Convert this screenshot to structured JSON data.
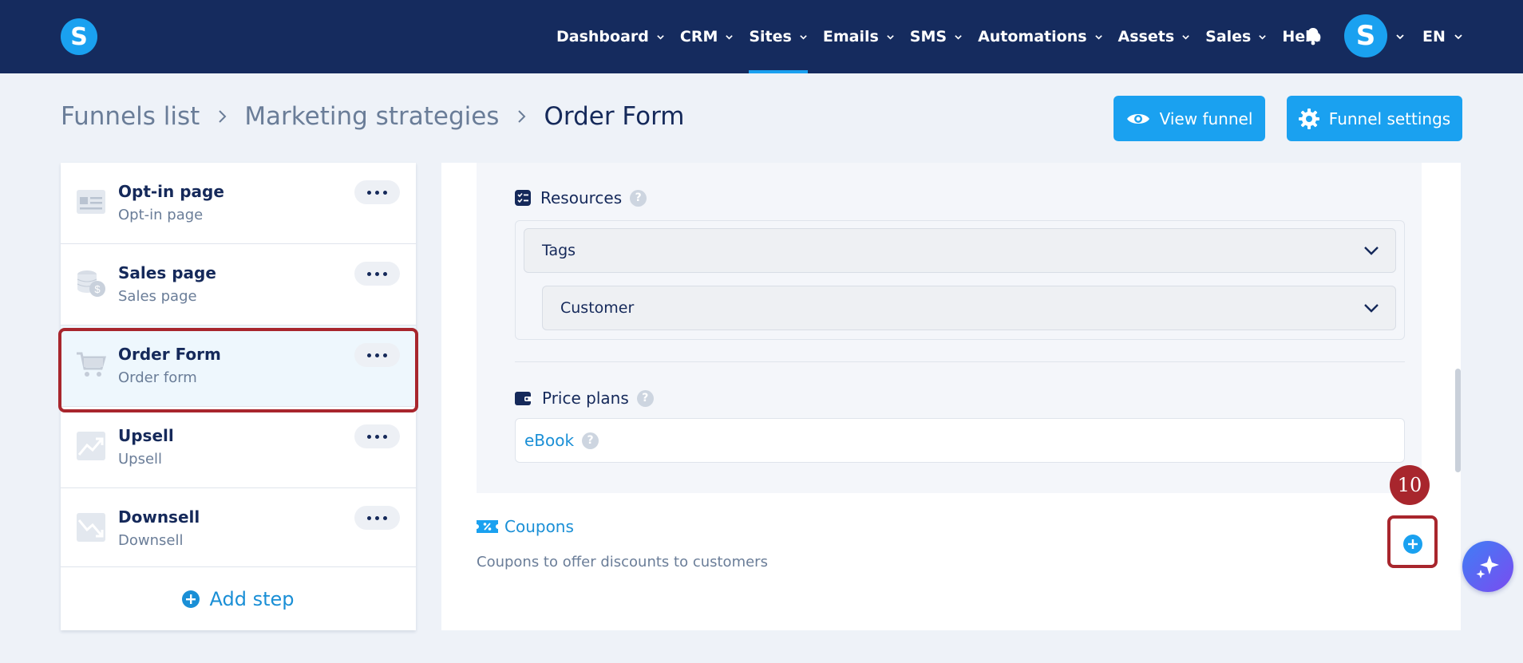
{
  "nav": {
    "items": [
      {
        "label": "Dashboard",
        "has_menu": true
      },
      {
        "label": "CRM",
        "has_menu": true
      },
      {
        "label": "Sites",
        "has_menu": true,
        "active": true
      },
      {
        "label": "Emails",
        "has_menu": true
      },
      {
        "label": "SMS",
        "has_menu": true
      },
      {
        "label": "Automations",
        "has_menu": true
      },
      {
        "label": "Assets",
        "has_menu": true
      },
      {
        "label": "Sales",
        "has_menu": true
      },
      {
        "label": "Help",
        "has_menu": false
      }
    ],
    "logo_letter": "S",
    "avatar_letter": "S",
    "language": "EN"
  },
  "breadcrumb": {
    "items": [
      "Funnels list",
      "Marketing strategies",
      "Order Form"
    ]
  },
  "header": {
    "view_funnel_label": "View funnel",
    "funnel_settings_label": "Funnel settings"
  },
  "steps": {
    "items": [
      {
        "title": "Opt-in page",
        "subtitle": "Opt-in page",
        "icon": "opt-in-page-icon"
      },
      {
        "title": "Sales page",
        "subtitle": "Sales page",
        "icon": "coins-icon"
      },
      {
        "title": "Order Form",
        "subtitle": "Order form",
        "icon": "cart-icon",
        "selected": true
      },
      {
        "title": "Upsell",
        "subtitle": "Upsell",
        "icon": "trend-up-icon"
      },
      {
        "title": "Downsell",
        "subtitle": "Downsell",
        "icon": "trend-down-icon"
      }
    ],
    "add_label": "Add step"
  },
  "main": {
    "resources_label": "Resources",
    "resources": {
      "tags_select": "Tags",
      "tag_value_select": "Customer"
    },
    "price_plans_label": "Price plans",
    "price_plan_item": "eBook",
    "help_glyph": "?",
    "coupons_label": "Coupons",
    "coupons_description": "Coupons to offer discounts to customers"
  },
  "annotation": {
    "step_number": "10"
  },
  "colors": {
    "navbar": "#152b5e",
    "accent": "#1aa1f0",
    "highlight": "#a8262d",
    "text_primary": "#15295a",
    "text_muted": "#6a7d98"
  }
}
